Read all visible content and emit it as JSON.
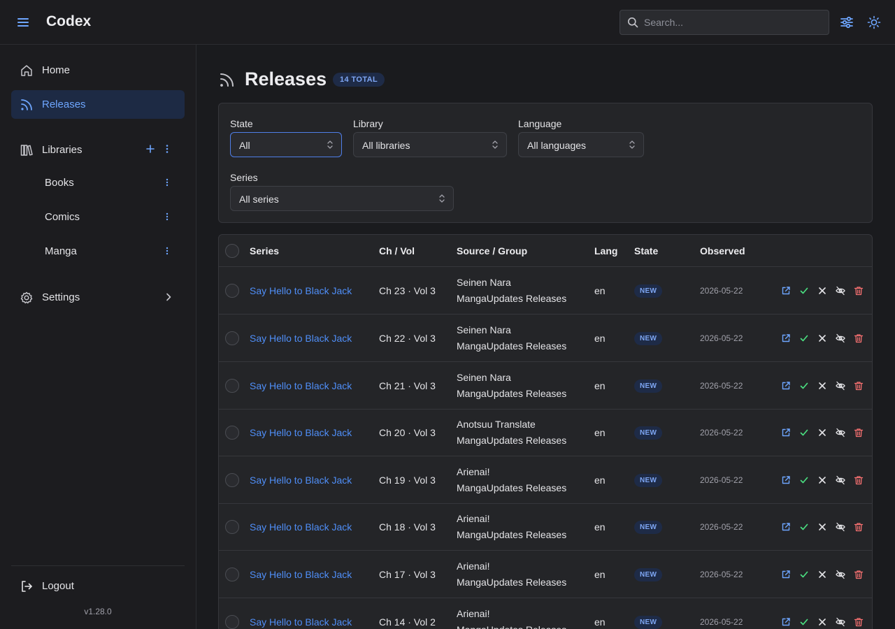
{
  "header": {
    "app_title": "Codex",
    "search_placeholder": "Search...",
    "icons": [
      "menu-icon",
      "search-icon",
      "sliders-icon",
      "sun-icon"
    ]
  },
  "sidebar": {
    "home": "Home",
    "releases": "Releases",
    "libraries": "Libraries",
    "library_items": [
      "Books",
      "Comics",
      "Manga"
    ],
    "settings": "Settings",
    "logout": "Logout",
    "version": "v1.28.0"
  },
  "page": {
    "title": "Releases",
    "total_badge": "14 TOTAL"
  },
  "filters": {
    "state": {
      "label": "State",
      "value": "All"
    },
    "library": {
      "label": "Library",
      "value": "All libraries"
    },
    "language": {
      "label": "Language",
      "value": "All languages"
    },
    "series": {
      "label": "Series",
      "value": "All series"
    }
  },
  "table": {
    "headers": {
      "series": "Series",
      "ch_vol": "Ch / Vol",
      "source": "Source / Group",
      "lang": "Lang",
      "state": "State",
      "observed": "Observed"
    },
    "rows": [
      {
        "series": "Say Hello to Black Jack",
        "ch_vol": "Ch 23 · Vol 3",
        "group": "Seinen Nara",
        "source": "MangaUpdates Releases",
        "lang": "en",
        "state": "NEW",
        "observed": "2026-05-22"
      },
      {
        "series": "Say Hello to Black Jack",
        "ch_vol": "Ch 22 · Vol 3",
        "group": "Seinen Nara",
        "source": "MangaUpdates Releases",
        "lang": "en",
        "state": "NEW",
        "observed": "2026-05-22"
      },
      {
        "series": "Say Hello to Black Jack",
        "ch_vol": "Ch 21 · Vol 3",
        "group": "Seinen Nara",
        "source": "MangaUpdates Releases",
        "lang": "en",
        "state": "NEW",
        "observed": "2026-05-22"
      },
      {
        "series": "Say Hello to Black Jack",
        "ch_vol": "Ch 20 · Vol 3",
        "group": "Anotsuu Translate",
        "source": "MangaUpdates Releases",
        "lang": "en",
        "state": "NEW",
        "observed": "2026-05-22"
      },
      {
        "series": "Say Hello to Black Jack",
        "ch_vol": "Ch 19 · Vol 3",
        "group": "Arienai!",
        "source": "MangaUpdates Releases",
        "lang": "en",
        "state": "NEW",
        "observed": "2026-05-22"
      },
      {
        "series": "Say Hello to Black Jack",
        "ch_vol": "Ch 18 · Vol 3",
        "group": "Arienai!",
        "source": "MangaUpdates Releases",
        "lang": "en",
        "state": "NEW",
        "observed": "2026-05-22"
      },
      {
        "series": "Say Hello to Black Jack",
        "ch_vol": "Ch 17 · Vol 3",
        "group": "Arienai!",
        "source": "MangaUpdates Releases",
        "lang": "en",
        "state": "NEW",
        "observed": "2026-05-22"
      },
      {
        "series": "Say Hello to Black Jack",
        "ch_vol": "Ch 14 · Vol 2",
        "group": "Arienai!",
        "source": "MangaUpdates Releases",
        "lang": "en",
        "state": "NEW",
        "observed": "2026-05-22"
      }
    ],
    "row_actions": [
      "external-link-icon",
      "check-icon",
      "x-icon",
      "eye-off-icon",
      "trash-icon"
    ]
  },
  "colors": {
    "background": "#1a1b1e",
    "panel": "#242528",
    "accent": "#4f8ef7",
    "badge_bg": "#1e2b47",
    "success": "#4ade80",
    "danger": "#f87171"
  }
}
